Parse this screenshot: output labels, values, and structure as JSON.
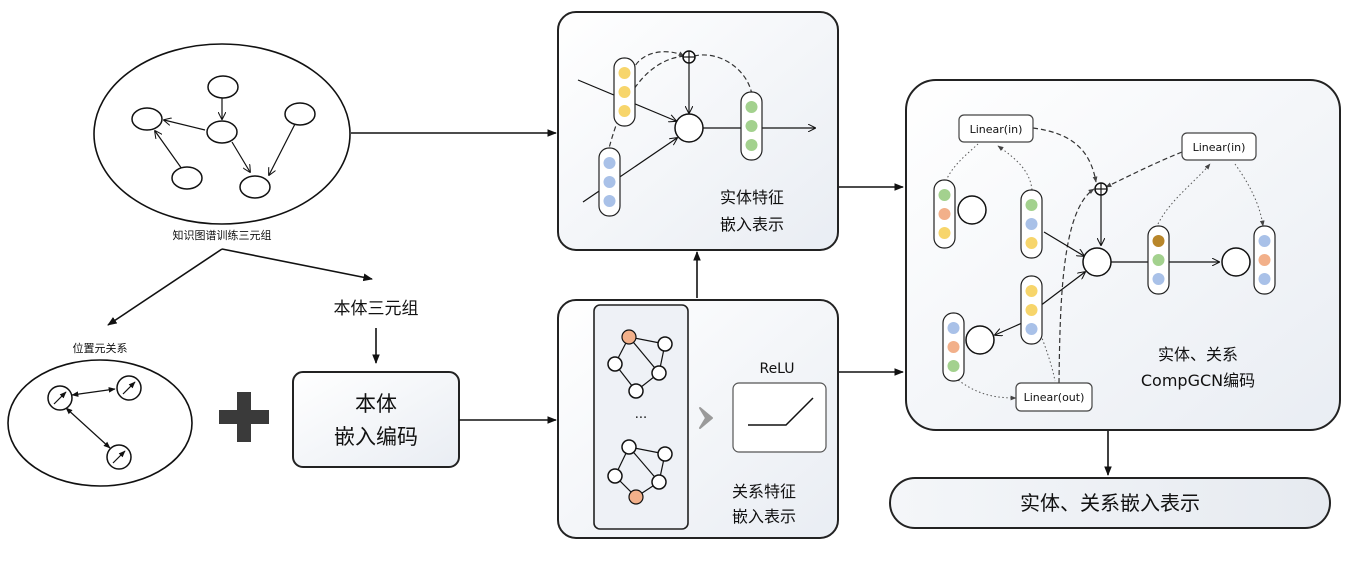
{
  "labels": {
    "kg_triples": "知识图谱训练三元组",
    "position_relation": "位置元关系",
    "ontology_triples": "本体三元组",
    "ontology_encoding_l1": "本体",
    "ontology_encoding_l2": "嵌入编码",
    "entity_feature_l1": "实体特征",
    "entity_feature_l2": "嵌入表示",
    "relation_feature_l1": "关系特征",
    "relation_feature_l2": "嵌入表示",
    "relu": "ReLU",
    "ellipsis": "...",
    "compgcn_l1": "实体、关系",
    "compgcn_l2": "CompGCN编码",
    "linear_in_1": "Linear(in)",
    "linear_in_2": "Linear(in)",
    "linear_out": "Linear(out)",
    "final_output": "实体、关系嵌入表示"
  },
  "colors": {
    "yellow": "#f7d56b",
    "blue": "#a9c1e8",
    "green": "#a3d18e",
    "orange": "#f2b08a",
    "brown": "#b8862a",
    "plus_sign": "#3a3a3a",
    "chevron": "#9a9a9a"
  }
}
